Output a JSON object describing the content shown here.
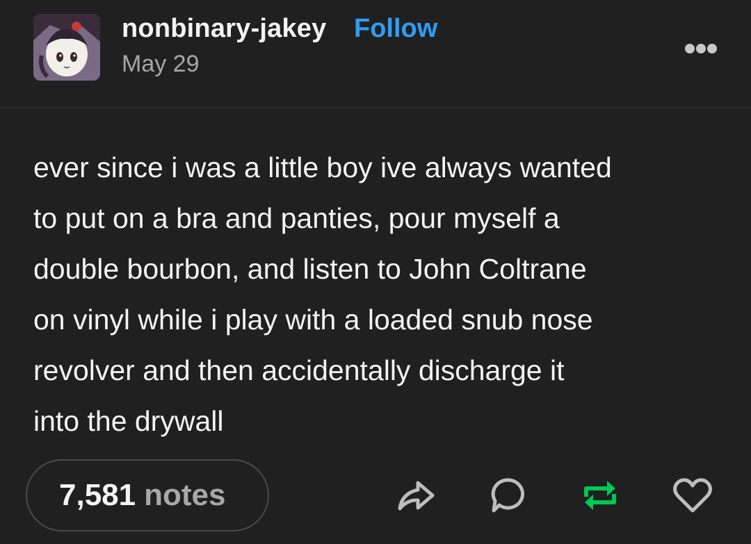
{
  "post": {
    "author": "nonbinary-jakey",
    "follow_label": "Follow",
    "date": "May 29",
    "body_lines": [
      "ever since i was a little boy ive always wanted",
      "to put on a bra and panties, pour myself a",
      "double bourbon, and listen to John Coltrane",
      "on vinyl while i play with a loaded snub nose",
      "revolver and then accidentally discharge it",
      "into the drywall"
    ]
  },
  "footer": {
    "notes_count": "7,581",
    "notes_label": "notes"
  },
  "icons": {
    "avatar": "avatar-cartoon-icon",
    "more": "more-options-icon",
    "share": "share-icon",
    "reply": "reply-icon",
    "reblog": "reblog-icon",
    "like": "heart-icon"
  },
  "colors": {
    "background": "#202020",
    "follow": "#2f9df4",
    "reblog": "#00c853",
    "muted": "#a6a6a6"
  }
}
